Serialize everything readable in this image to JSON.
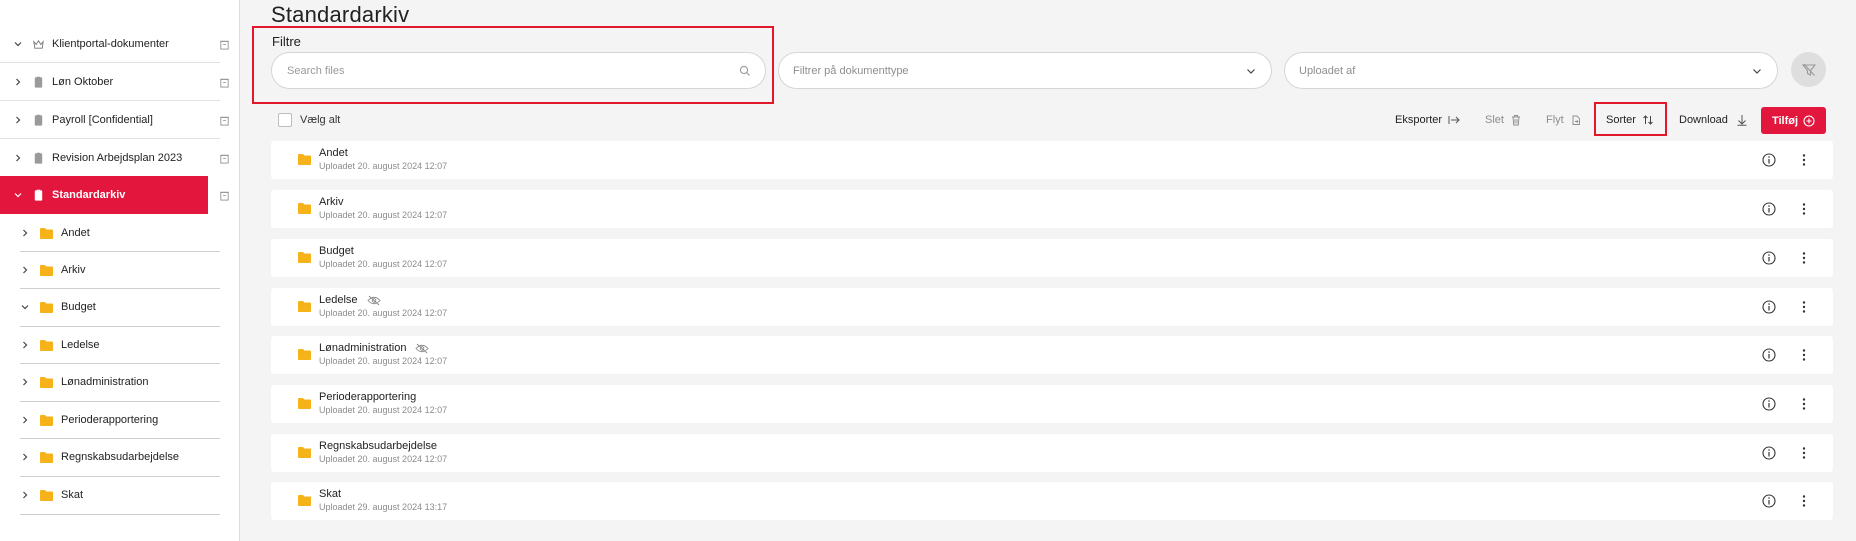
{
  "sidebar": {
    "top_items": [
      {
        "label": "Klientportal-dokumenter",
        "icon": "crown-icon",
        "expanded": true
      },
      {
        "label": "Løn Oktober",
        "icon": "document-icon",
        "expanded": false
      },
      {
        "label": "Payroll [Confidential]",
        "icon": "document-icon",
        "expanded": false
      },
      {
        "label": "Revision Arbejdsplan 2023",
        "icon": "document-icon",
        "expanded": false
      },
      {
        "label": "Standardarkiv",
        "icon": "document-icon",
        "expanded": true,
        "active": true
      }
    ],
    "sub_items": [
      {
        "label": "Andet",
        "expanded": false
      },
      {
        "label": "Arkiv",
        "expanded": false
      },
      {
        "label": "Budget",
        "expanded": true
      },
      {
        "label": "Ledelse",
        "expanded": false
      },
      {
        "label": "Lønadministration",
        "expanded": false
      },
      {
        "label": "Perioderapportering",
        "expanded": false
      },
      {
        "label": "Regnskabsudarbejdelse",
        "expanded": false
      },
      {
        "label": "Skat",
        "expanded": false
      }
    ]
  },
  "main": {
    "title": "Standardarkiv",
    "filters_label": "Filtre",
    "search_placeholder": "Search files",
    "doctype_placeholder": "Filtrer på dokumenttype",
    "uploader_placeholder": "Uploadet af",
    "select_all": "Vælg alt",
    "toolbar": {
      "export": "Eksporter",
      "delete": "Slet",
      "move": "Flyt",
      "sort": "Sorter",
      "download": "Download",
      "add": "Tilføj"
    },
    "files": [
      {
        "name": "Andet",
        "uploaded": "Uploadet 20. august 2024 12:07",
        "hidden": false
      },
      {
        "name": "Arkiv",
        "uploaded": "Uploadet 20. august 2024 12:07",
        "hidden": false
      },
      {
        "name": "Budget",
        "uploaded": "Uploadet 20. august 2024 12:07",
        "hidden": false
      },
      {
        "name": "Ledelse",
        "uploaded": "Uploadet 20. august 2024 12:07",
        "hidden": true
      },
      {
        "name": "Lønadministration",
        "uploaded": "Uploadet 20. august 2024 12:07",
        "hidden": true
      },
      {
        "name": "Perioderapportering",
        "uploaded": "Uploadet 20. august 2024 12:07",
        "hidden": false
      },
      {
        "name": "Regnskabsudarbejdelse",
        "uploaded": "Uploadet 20. august 2024 12:07",
        "hidden": false
      },
      {
        "name": "Skat",
        "uploaded": "Uploadet 29. august 2024 13:17",
        "hidden": false
      }
    ]
  },
  "colors": {
    "accent": "#e3173e",
    "folder": "#f5b219",
    "highlight": "#e3172a"
  }
}
